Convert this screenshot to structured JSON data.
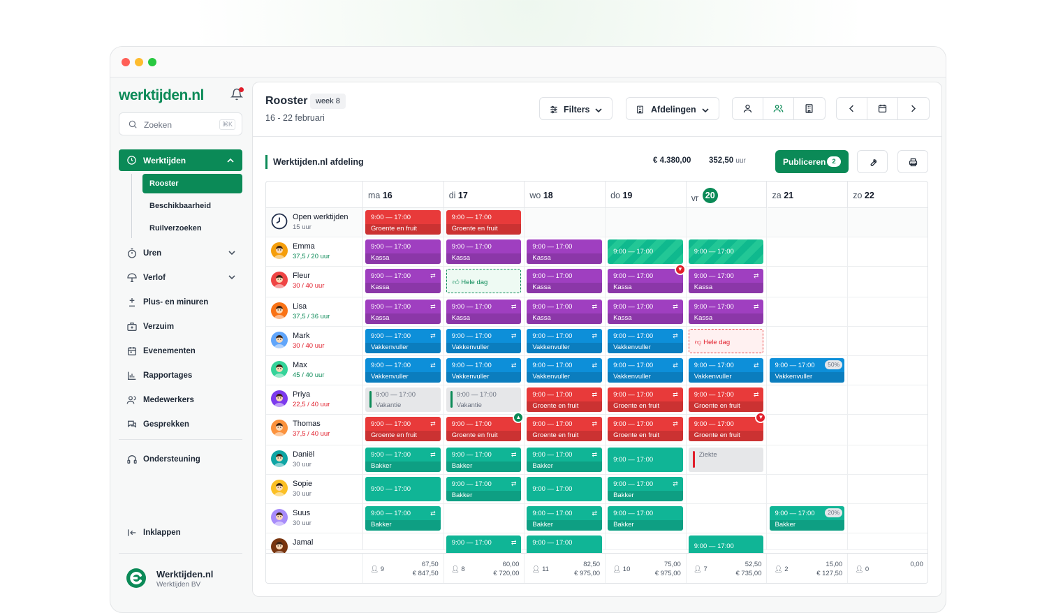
{
  "sidebar": {
    "logo": "werktijden.nl",
    "search_placeholder": "Zoeken",
    "search_shortcut": "⌘K",
    "nav_active": "Werktijden",
    "sub_items": [
      "Rooster",
      "Beschikbaarheid",
      "Ruilverzoeken"
    ],
    "items": [
      {
        "label": "Uren",
        "icon": "stopwatch-icon",
        "expandable": true
      },
      {
        "label": "Verlof",
        "icon": "beach-umbrella-icon",
        "expandable": true
      },
      {
        "label": "Plus- en minuren",
        "icon": "plus-minus-icon",
        "expandable": false
      },
      {
        "label": "Verzuim",
        "icon": "medical-case-icon",
        "expandable": false
      },
      {
        "label": "Evenementen",
        "icon": "calendar-event-icon",
        "expandable": false
      },
      {
        "label": "Rapportages",
        "icon": "bar-chart-icon",
        "expandable": false
      },
      {
        "label": "Medewerkers",
        "icon": "users-icon",
        "expandable": false
      },
      {
        "label": "Gesprekken",
        "icon": "chat-icon",
        "expandable": false
      }
    ],
    "support": "Ondersteuning",
    "collapse": "Inklappen",
    "company_name": "Werktijden.nl",
    "company_sub": "Werktijden BV"
  },
  "header": {
    "title": "Rooster",
    "week": "week 8",
    "range": "16 - 22 februari",
    "filters_label": "Filters",
    "departments_label": "Afdelingen"
  },
  "toolbar": {
    "department": "Werktijden.nl afdeling",
    "total_cost": "€ 4.380,00",
    "total_hours": "352,50",
    "hours_unit": "uur",
    "publish_label": "Publiceren",
    "publish_count": "2"
  },
  "days": [
    {
      "dow": "ma",
      "num": "16",
      "today": false
    },
    {
      "dow": "di",
      "num": "17",
      "today": false
    },
    {
      "dow": "wo",
      "num": "18",
      "today": false
    },
    {
      "dow": "do",
      "num": "19",
      "today": false
    },
    {
      "dow": "vr",
      "num": "20",
      "today": true
    },
    {
      "dow": "za",
      "num": "21",
      "today": false
    },
    {
      "dow": "zo",
      "num": "22",
      "today": false
    }
  ],
  "colors": {
    "brand": "#0b8a57",
    "purple": "#9f3fc0",
    "red": "#e83a3a",
    "blue": "#0d8fd9",
    "teal": "#10b596"
  },
  "rows": [
    {
      "name": "Open werktijden",
      "hours": "15 uur",
      "hours_color": "#6b7280",
      "avatar": "clock-icon",
      "height": 42,
      "cells": [
        {
          "type": "shift",
          "time": "9:00 — 17:00",
          "dept": "Groente en fruit",
          "color": "red"
        },
        {
          "type": "shift",
          "time": "9:00 — 17:00",
          "dept": "Groente en fruit",
          "color": "red"
        },
        null,
        null,
        null,
        null,
        null
      ]
    },
    {
      "name": "Emma",
      "hours": "37,5 / 20 uur",
      "hours_color": "#0b8a57",
      "avatar": "#f59e0b",
      "height": 42,
      "cells": [
        {
          "type": "shift",
          "time": "9:00 — 17:00",
          "dept": "Kassa",
          "color": "purple"
        },
        {
          "type": "shift",
          "time": "9:00 — 17:00",
          "dept": "Kassa",
          "color": "purple"
        },
        {
          "type": "shift",
          "time": "9:00 — 17:00",
          "dept": "Kassa",
          "color": "purple"
        },
        {
          "type": "avail",
          "time": "9:00 — 17:00"
        },
        {
          "type": "avail",
          "time": "9:00 — 17:00"
        },
        null,
        null
      ]
    },
    {
      "name": "Fleur",
      "hours": "30 / 40 uur",
      "hours_color": "#e11d2a",
      "avatar": "#ef4444",
      "height": 44,
      "cells": [
        {
          "type": "shift",
          "time": "9:00 — 17:00",
          "dept": "Kassa",
          "color": "purple",
          "swap": true
        },
        {
          "type": "pref",
          "label": "Hele dag"
        },
        {
          "type": "shift",
          "time": "9:00 — 17:00",
          "dept": "Kassa",
          "color": "purple"
        },
        {
          "type": "shift",
          "time": "9:00 — 17:00",
          "dept": "Kassa",
          "color": "purple",
          "flag": "down"
        },
        {
          "type": "shift",
          "time": "9:00 — 17:00",
          "dept": "Kassa",
          "color": "purple",
          "swap": true
        },
        null,
        null
      ]
    },
    {
      "name": "Lisa",
      "hours": "37,5 / 36 uur",
      "hours_color": "#0b8a57",
      "avatar": "#f97316",
      "height": 42,
      "cells": [
        {
          "type": "shift",
          "time": "9:00 — 17:00",
          "dept": "Kassa",
          "color": "purple",
          "swap": true
        },
        {
          "type": "shift",
          "time": "9:00 — 17:00",
          "dept": "Kassa",
          "color": "purple",
          "swap": true
        },
        {
          "type": "shift",
          "time": "9:00 — 17:00",
          "dept": "Kassa",
          "color": "purple",
          "swap": true
        },
        {
          "type": "shift",
          "time": "9:00 — 17:00",
          "dept": "Kassa",
          "color": "purple",
          "swap": true
        },
        {
          "type": "shift",
          "time": "9:00 — 17:00",
          "dept": "Kassa",
          "color": "purple",
          "swap": true
        },
        null,
        null
      ]
    },
    {
      "name": "Mark",
      "hours": "30 / 40 uur",
      "hours_color": "#e11d2a",
      "avatar": "#60a5fa",
      "height": 42,
      "cells": [
        {
          "type": "shift",
          "time": "9:00 — 17:00",
          "dept": "Vakkenvuller",
          "color": "blue",
          "swap": true
        },
        {
          "type": "shift",
          "time": "9:00 — 17:00",
          "dept": "Vakkenvuller",
          "color": "blue",
          "swap": true
        },
        {
          "type": "shift",
          "time": "9:00 — 17:00",
          "dept": "Vakkenvuller",
          "color": "blue",
          "swap": true
        },
        {
          "type": "shift",
          "time": "9:00 — 17:00",
          "dept": "Vakkenvuller",
          "color": "blue",
          "swap": true
        },
        {
          "type": "unavail",
          "label": "Hele dag"
        },
        null,
        null
      ]
    },
    {
      "name": "Max",
      "hours": "45 / 40 uur",
      "hours_color": "#0b8a57",
      "avatar": "#34d399",
      "height": 42,
      "cells": [
        {
          "type": "shift",
          "time": "9:00 — 17:00",
          "dept": "Vakkenvuller",
          "color": "blue",
          "swap": true
        },
        {
          "type": "shift",
          "time": "9:00 — 17:00",
          "dept": "Vakkenvuller",
          "color": "blue",
          "swap": true
        },
        {
          "type": "shift",
          "time": "9:00 — 17:00",
          "dept": "Vakkenvuller",
          "color": "blue",
          "swap": true
        },
        {
          "type": "shift",
          "time": "9:00 — 17:00",
          "dept": "Vakkenvuller",
          "color": "blue",
          "swap": true
        },
        {
          "type": "shift",
          "time": "9:00 — 17:00",
          "dept": "Vakkenvuller",
          "color": "blue",
          "swap": true
        },
        {
          "type": "shift",
          "time": "9:00 — 17:00",
          "dept": "Vakkenvuller",
          "color": "blue",
          "pct": "50%"
        },
        null
      ]
    },
    {
      "name": "Priya",
      "hours": "22,5 / 40 uur",
      "hours_color": "#e11d2a",
      "avatar": "#7c3aed",
      "height": 42,
      "cells": [
        {
          "type": "leave",
          "time": "9:00 — 17:00",
          "label": "Vakantie",
          "bar": "#0b8a57"
        },
        {
          "type": "leave",
          "time": "9:00 — 17:00",
          "label": "Vakantie",
          "bar": "#0b8a57"
        },
        {
          "type": "shift",
          "time": "9:00 — 17:00",
          "dept": "Groente en fruit",
          "color": "red",
          "swap": true
        },
        {
          "type": "shift",
          "time": "9:00 — 17:00",
          "dept": "Groente en fruit",
          "color": "red",
          "swap": true
        },
        {
          "type": "shift",
          "time": "9:00 — 17:00",
          "dept": "Groente en fruit",
          "color": "red",
          "swap": true
        },
        null,
        null
      ]
    },
    {
      "name": "Thomas",
      "hours": "37,5 / 40 uur",
      "hours_color": "#e11d2a",
      "avatar": "#fb923c",
      "height": 44,
      "cells": [
        {
          "type": "shift",
          "time": "9:00 — 17:00",
          "dept": "Groente en fruit",
          "color": "red",
          "swap": true
        },
        {
          "type": "shift",
          "time": "9:00 — 17:00",
          "dept": "Groente en fruit",
          "color": "red",
          "flag": "up"
        },
        {
          "type": "shift",
          "time": "9:00 — 17:00",
          "dept": "Groente en fruit",
          "color": "red",
          "swap": true
        },
        {
          "type": "shift",
          "time": "9:00 — 17:00",
          "dept": "Groente en fruit",
          "color": "red",
          "swap": true
        },
        {
          "type": "shift",
          "time": "9:00 — 17:00",
          "dept": "Groente en fruit",
          "color": "red",
          "flag": "down"
        },
        null,
        null
      ]
    },
    {
      "name": "Daniël",
      "hours": "30 uur",
      "hours_color": "#6b7280",
      "avatar": "#0ea5a4",
      "height": 42,
      "cells": [
        {
          "type": "shift",
          "time": "9:00 — 17:00",
          "dept": "Bakker",
          "color": "teal",
          "swap": true
        },
        {
          "type": "shift",
          "time": "9:00 — 17:00",
          "dept": "Bakker",
          "color": "teal",
          "swap": true
        },
        {
          "type": "shift",
          "time": "9:00 — 17:00",
          "dept": "Bakker",
          "color": "teal",
          "swap": true
        },
        {
          "type": "single",
          "time": "9:00 — 17:00",
          "color": "teal"
        },
        {
          "type": "leave",
          "time": "",
          "label": "Ziekte",
          "bar": "#e11d2a"
        },
        null,
        null
      ]
    },
    {
      "name": "Sopie",
      "hours": "30 uur",
      "hours_color": "#6b7280",
      "avatar": "#fbbf24",
      "height": 42,
      "cells": [
        {
          "type": "single",
          "time": "9:00 — 17:00",
          "color": "teal"
        },
        {
          "type": "shift",
          "time": "9:00 — 17:00",
          "dept": "Bakker",
          "color": "teal",
          "swap": true
        },
        {
          "type": "single",
          "time": "9:00 — 17:00",
          "color": "teal"
        },
        {
          "type": "shift",
          "time": "9:00 — 17:00",
          "dept": "Bakker",
          "color": "teal",
          "swap": true
        },
        null,
        null,
        null
      ]
    },
    {
      "name": "Suus",
      "hours": "30 uur",
      "hours_color": "#6b7280",
      "avatar": "#a78bfa",
      "height": 42,
      "cells": [
        {
          "type": "shift",
          "time": "9:00 — 17:00",
          "dept": "Bakker",
          "color": "teal",
          "swap": true
        },
        null,
        {
          "type": "shift",
          "time": "9:00 — 17:00",
          "dept": "Bakker",
          "color": "teal",
          "swap": true
        },
        {
          "type": "shift",
          "time": "9:00 — 17:00",
          "dept": "Bakker",
          "color": "teal"
        },
        null,
        {
          "type": "shift",
          "time": "9:00 — 17:00",
          "dept": "Bakker",
          "color": "teal",
          "pct": "20%"
        },
        null
      ]
    },
    {
      "name": "Jamal",
      "hours": "",
      "hours_color": "#6b7280",
      "avatar": "#78350f",
      "height": 24,
      "cells": [
        null,
        {
          "type": "shift",
          "time": "9:00 — 17:00",
          "dept": "",
          "color": "teal",
          "swap": true
        },
        {
          "type": "shift",
          "time": "9:00 — 17:00",
          "dept": "",
          "color": "teal"
        },
        null,
        {
          "type": "lowshift",
          "time": "9:00 — 17:00",
          "color": "teal"
        },
        null,
        null
      ]
    }
  ],
  "footer": [
    {
      "count": "9",
      "hours": "67,50",
      "money": "€ 847,50"
    },
    {
      "count": "8",
      "hours": "60,00",
      "money": "€ 720,00"
    },
    {
      "count": "11",
      "hours": "82,50",
      "money": "€ 975,00"
    },
    {
      "count": "10",
      "hours": "75,00",
      "money": "€ 975,00"
    },
    {
      "count": "7",
      "hours": "52,50",
      "money": "€ 735,00"
    },
    {
      "count": "2",
      "hours": "15,00",
      "money": "€ 127,50"
    },
    {
      "count": "0",
      "hours": "0,00",
      "money": ""
    }
  ]
}
